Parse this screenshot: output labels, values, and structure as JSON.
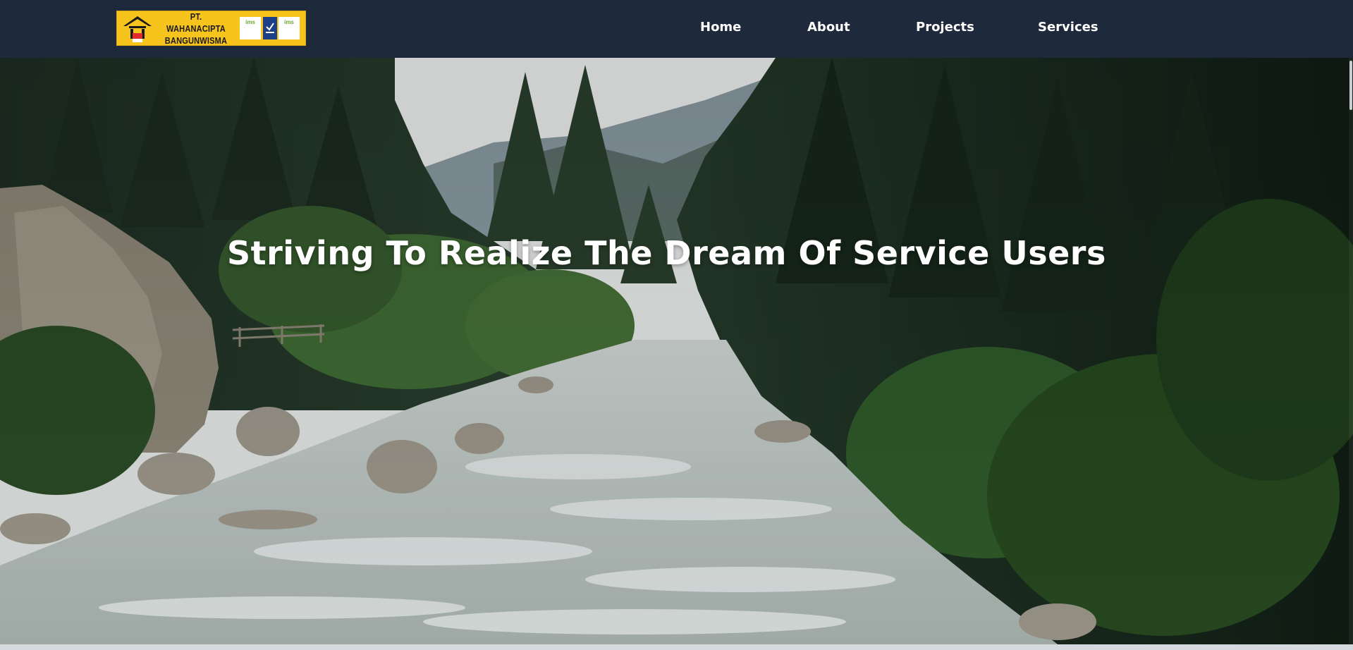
{
  "header": {
    "logo": {
      "company_line1": "PT. WAHANACIPTA",
      "company_line2": "BANGUNWISMA",
      "cert1": "ims",
      "cert2": "ims"
    },
    "nav": [
      {
        "label": "Home"
      },
      {
        "label": "About"
      },
      {
        "label": "Projects"
      },
      {
        "label": "Services"
      }
    ]
  },
  "hero": {
    "title": "Striving To Realize The Dream Of Service Users"
  },
  "colors": {
    "navbar_bg": "#1e293b",
    "logo_bg": "#f7c31d",
    "nav_text": "#ffffff",
    "hero_text": "#ffffff"
  },
  "icons": {
    "logo_mark": "house-roof-icon",
    "cert_badge": "certification-badge-icon"
  }
}
